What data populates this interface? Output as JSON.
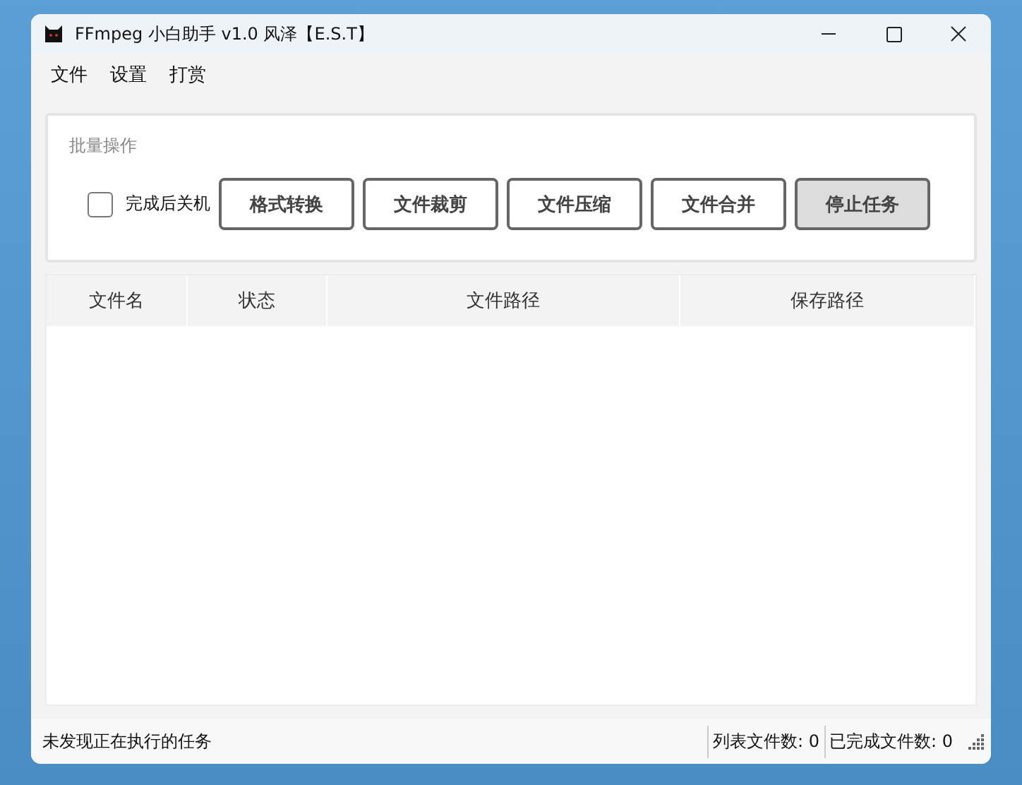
{
  "window": {
    "title": "FFmpeg 小白助手 v1.0 风泽【E.S.T】"
  },
  "menu": [
    "文件",
    "设置",
    "打赏"
  ],
  "batch": {
    "title": "批量操作",
    "shutdown": {
      "label": "完成后关机",
      "checked": false
    },
    "buttons": [
      {
        "label": "格式转换",
        "default": false
      },
      {
        "label": "文件裁剪",
        "default": false
      },
      {
        "label": "文件压缩",
        "default": false
      },
      {
        "label": "文件合并",
        "default": false
      },
      {
        "label": "停止任务",
        "default": true
      }
    ]
  },
  "table": {
    "columns": [
      "文件名",
      "状态",
      "文件路径",
      "保存路径"
    ]
  },
  "status_bar": {
    "message": "未发现正在执行的任务",
    "counts": [
      "列表文件数: 0",
      "已完成文件数: 0"
    ]
  }
}
